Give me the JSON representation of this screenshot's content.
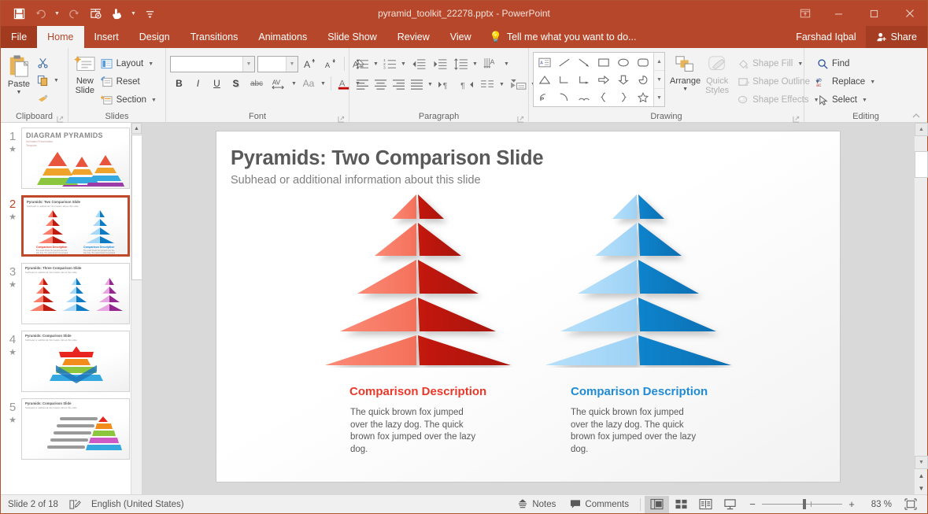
{
  "titlebar": {
    "document_title": "pyramid_toolkit_22278.pptx - PowerPoint",
    "qat": [
      {
        "name": "save-icon",
        "label": "Save"
      },
      {
        "name": "undo-icon",
        "label": "Undo"
      },
      {
        "name": "redo-icon",
        "label": "Redo"
      },
      {
        "name": "start-slideshow-icon",
        "label": "Start From Beginning"
      },
      {
        "name": "touch-mouse-mode-icon",
        "label": "Touch/Mouse Mode"
      },
      {
        "name": "customize-qat-icon",
        "label": "Customize Quick Access Toolbar"
      }
    ],
    "window": {
      "ribbon_display": "Ribbon Display Options",
      "minimize": "—",
      "maximize": "☐",
      "close": "✕"
    }
  },
  "tabs": [
    {
      "label": "File",
      "active": false
    },
    {
      "label": "Home",
      "active": true
    },
    {
      "label": "Insert",
      "active": false
    },
    {
      "label": "Design",
      "active": false
    },
    {
      "label": "Transitions",
      "active": false
    },
    {
      "label": "Animations",
      "active": false
    },
    {
      "label": "Slide Show",
      "active": false
    },
    {
      "label": "Review",
      "active": false
    },
    {
      "label": "View",
      "active": false
    }
  ],
  "tellme": {
    "label": "Tell me what you want to do..."
  },
  "account": {
    "user": "Farshad Iqbal",
    "share_label": "Share"
  },
  "ribbon": {
    "clipboard": {
      "group_label": "Clipboard",
      "paste_label": "Paste",
      "cut_label": "Cut",
      "copy_label": "Copy",
      "format_painter_label": "Format Painter"
    },
    "slides": {
      "group_label": "Slides",
      "new_slide_label": "New\nSlide",
      "new_slide_line1": "New",
      "new_slide_line2": "Slide",
      "layout_label": "Layout",
      "reset_label": "Reset",
      "section_label": "Section"
    },
    "font": {
      "group_label": "Font",
      "font_name_value": "",
      "font_name_placeholder": "",
      "font_size_value": "",
      "grow_font_label": "A",
      "shrink_font_label": "A",
      "clear_formatting_label": "Clear All Formatting",
      "bold_label": "B",
      "italic_label": "I",
      "underline_label": "U",
      "shadow_label": "S",
      "strikethrough_label": "abc",
      "character_spacing_label": "AV",
      "change_case_label": "Aa",
      "font_color_label": "A"
    },
    "paragraph": {
      "group_label": "Paragraph",
      "bullets_label": "Bullets",
      "numbering_label": "Numbering",
      "decrease_indent_label": "Decrease List Level",
      "increase_indent_label": "Increase List Level",
      "line_spacing_label": "Line Spacing",
      "text_direction_label": "Text Direction",
      "align_text_label": "Align Text",
      "convert_smartart_label": "Convert to SmartArt",
      "align_left_label": "Align Left",
      "center_label": "Center",
      "align_right_label": "Align Right",
      "justify_label": "Justify",
      "ltr_label": "Left-to-Right",
      "rtl_label": "Right-to-Left",
      "columns_label": "Columns"
    },
    "drawing": {
      "group_label": "Drawing",
      "arrange_label": "Arrange",
      "quick_styles_line1": "Quick",
      "quick_styles_line2": "Styles",
      "shape_fill_label": "Shape Fill",
      "shape_outline_label": "Shape Outline",
      "shape_effects_label": "Shape Effects",
      "shapes": [
        "text-box-shape",
        "line-shape",
        "arrow-shape",
        "rectangle-shape",
        "oval-shape",
        "rounded-rectangle-shape",
        "triangle-shape",
        "elbow-connector-shape",
        "elbow-arrow-connector-shape",
        "right-arrow-shape",
        "down-arrow-shape",
        "pie-shape",
        "scribble-shape",
        "arc-shape",
        "double-arc-shape",
        "left-brace-shape",
        "right-brace-shape",
        "star-shape"
      ]
    },
    "editing": {
      "group_label": "Editing",
      "find_label": "Find",
      "replace_label": "Replace",
      "select_label": "Select",
      "collapse_ribbon_label": "Collapse the Ribbon"
    }
  },
  "thumbnails": [
    {
      "number": "1",
      "title": "DIAGRAM PYRAMIDS",
      "subtitle": "Animated Presentation Template",
      "selected": false,
      "style": "cover"
    },
    {
      "number": "2",
      "title": "Pyramids: Two Comparison Slide",
      "subtitle": "Subhead or additional information about this slide",
      "selected": true,
      "style": "two"
    },
    {
      "number": "3",
      "title": "Pyramids: Three Comparison Slide",
      "subtitle": "Subhead or additional information about this slide",
      "selected": false,
      "style": "three"
    },
    {
      "number": "4",
      "title": "Pyramids: Comparison Slide",
      "subtitle": "Subhead or additional information about this slide",
      "selected": false,
      "style": "chevron"
    },
    {
      "number": "5",
      "title": "Pyramids: Comparison Slide",
      "subtitle": "Subhead or additional information about this slide",
      "selected": false,
      "style": "steps"
    }
  ],
  "slide": {
    "title": "Pyramids: Two Comparison Slide",
    "subhead": "Subhead or additional information about this slide",
    "columns": [
      {
        "heading": "Comparison Description",
        "body": "The quick brown fox jumped over the lazy dog. The quick brown fox jumped over the lazy dog.",
        "heading_color": "#e8392a",
        "face_light": "#f97d68",
        "face_dark": "#bf1a10",
        "levels": 5
      },
      {
        "heading": "Comparison Description",
        "body": "The quick brown fox jumped over the lazy dog. The quick brown fox jumped over the lazy dog.",
        "heading_color": "#1f8bd6",
        "face_light": "#a7d8f7",
        "face_dark": "#0d7cc4",
        "levels": 5
      }
    ]
  },
  "statusbar": {
    "slide_indicator": "Slide 2 of 18",
    "language": "English (United States)",
    "spellcheck_icon": "proofing-icon",
    "notes_label": "Notes",
    "comments_label": "Comments",
    "views": [
      {
        "name": "normal-view-button",
        "label": "Normal",
        "active": true
      },
      {
        "name": "slide-sorter-view-button",
        "label": "Slide Sorter",
        "active": false
      },
      {
        "name": "reading-view-button",
        "label": "Reading View",
        "active": false
      },
      {
        "name": "slide-show-view-button",
        "label": "Slide Show",
        "active": false
      }
    ],
    "zoom_out": "−",
    "zoom_in": "+",
    "zoom_level": "83 %",
    "fit_slide_label": "Fit slide to current window"
  },
  "colors": {
    "accent": "#b7472a",
    "ribbon_bg": "#f3f3f3",
    "canvas_bg": "#d9d9d9"
  }
}
